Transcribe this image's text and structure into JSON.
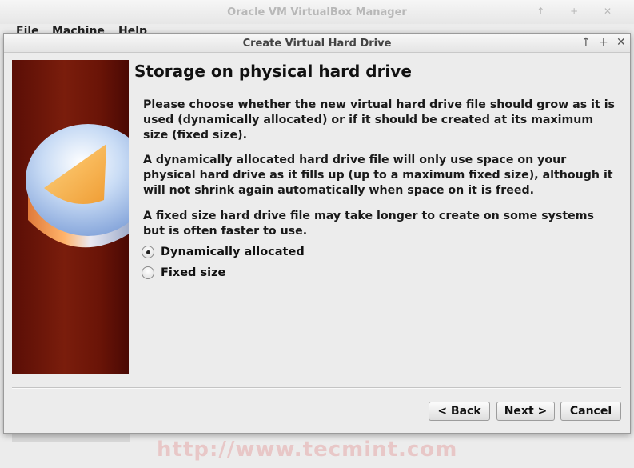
{
  "background_window": {
    "title": "Oracle VM VirtualBox Manager",
    "controls": "↑ + ✕",
    "menu": [
      "File",
      "Machine",
      "Help"
    ]
  },
  "dialog": {
    "title": "Create Virtual Hard Drive",
    "controls": {
      "up": "↑",
      "max": "+",
      "close": "✕"
    },
    "heading": "Storage on physical hard drive",
    "paragraphs": [
      "Please choose whether the new virtual hard drive file should grow as it is used (dynamically allocated) or if it should be created at its maximum size (fixed size).",
      "A dynamically allocated hard drive file will only use space on your physical hard drive as it fills up (up to a maximum fixed size), although it will not shrink again automatically when space on it is freed.",
      "A fixed size hard drive file may take longer to create on some systems but is often faster to use."
    ],
    "options": [
      {
        "label": "Dynamically allocated",
        "selected": true
      },
      {
        "label": "Fixed size",
        "selected": false
      }
    ],
    "buttons": {
      "back": "< Back",
      "next": "Next >",
      "cancel": "Cancel"
    }
  },
  "watermark": "http://www.tecmint.com"
}
